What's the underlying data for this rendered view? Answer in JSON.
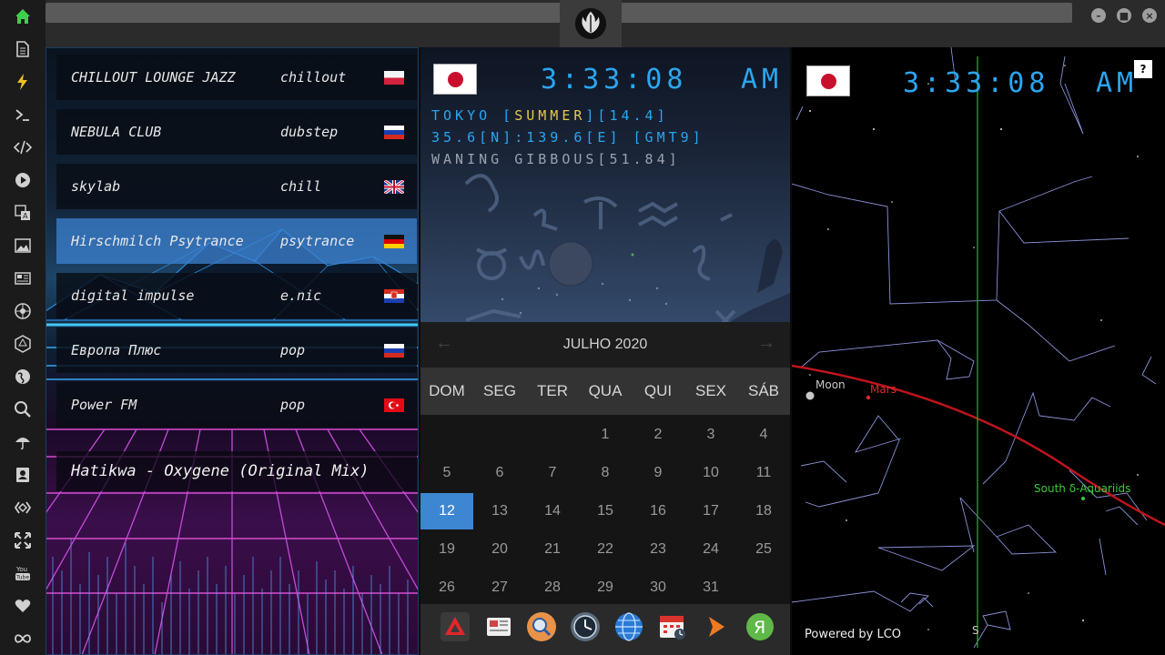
{
  "sidebar": {
    "items": [
      {
        "name": "home-icon",
        "glyph": "home"
      },
      {
        "name": "document-icon",
        "glyph": "doc"
      },
      {
        "name": "lightning-icon",
        "glyph": "bolt"
      },
      {
        "name": "terminal-icon",
        "glyph": ">_"
      },
      {
        "name": "code-icon",
        "glyph": "</>"
      },
      {
        "name": "play-icon",
        "glyph": "play"
      },
      {
        "name": "translate-icon",
        "glyph": "trans"
      },
      {
        "name": "image-icon",
        "glyph": "img"
      },
      {
        "name": "newspaper-icon",
        "glyph": "news"
      },
      {
        "name": "rebel-alliance-icon",
        "glyph": "rebel"
      },
      {
        "name": "hexagon-icon",
        "glyph": "hex"
      },
      {
        "name": "globe-icon",
        "glyph": "globe"
      },
      {
        "name": "search-icon",
        "glyph": "search"
      },
      {
        "name": "umbrella-icon",
        "glyph": "umbrella"
      },
      {
        "name": "contact-icon",
        "glyph": "contact"
      },
      {
        "name": "diamond-link-icon",
        "glyph": "diamond"
      },
      {
        "name": "expand-icon",
        "glyph": "expand"
      },
      {
        "name": "youtube-icon",
        "glyph": "You Tube"
      },
      {
        "name": "heart-icon",
        "glyph": "heart"
      },
      {
        "name": "infinity-icon",
        "glyph": "infinity"
      }
    ],
    "accent": "#3fcf4a"
  },
  "topbar": {
    "logo_icon": "rebel-alliance-icon",
    "window_buttons": [
      "minimize",
      "maximize",
      "close"
    ]
  },
  "radio": {
    "stations": [
      {
        "name": "CHILLOUT LOUNGE JAZZ",
        "genre": "chillout",
        "flag": "poland"
      },
      {
        "name": "NEBULA CLUB",
        "genre": "dubstep",
        "flag": "russia"
      },
      {
        "name": "skylab",
        "genre": "chill",
        "flag": "uk"
      },
      {
        "name": "Hirschmilch Psytrance",
        "genre": "psytrance",
        "flag": "germany"
      },
      {
        "name": "digital impulse",
        "genre": "e.nic",
        "flag": "croatia"
      },
      {
        "name": "Европа Плюс",
        "genre": "pop",
        "flag": "russia"
      },
      {
        "name": "Power FM",
        "genre": "pop",
        "flag": "turkey"
      }
    ],
    "active_index": 3,
    "now_playing": "Hatikwa - Oxygene (Original Mix)"
  },
  "clock": {
    "time": "3:33:08",
    "ampm": "AM",
    "location_line_prefix": "TOKYO [",
    "season": "SUMMER",
    "location_line_suffix": "][14.4]",
    "coords_line": "35.6[N]:139.6[E] [GMT9]",
    "moon_line": "WANING GIBBOUS[51.84]",
    "digit_color": "#2aa6f0",
    "season_color": "#e8c84a"
  },
  "calendar": {
    "month_label": "JULHO 2020",
    "weekdays": [
      "DOM",
      "SEG",
      "TER",
      "QUA",
      "QUI",
      "SEX",
      "SÁB"
    ],
    "first_weekday_index": 3,
    "days_in_month": 31,
    "today": 12,
    "prev_label": "←",
    "next_label": "→",
    "today_color": "#3d86d2"
  },
  "dock": {
    "icons": [
      "anydesk-icon",
      "news-reader-icon",
      "search-app-icon",
      "clock-app-icon",
      "browser-globe-icon",
      "calendar-app-icon",
      "arrow-app-icon",
      "yandex-icon"
    ]
  },
  "starmap": {
    "time": "3:33:08",
    "ampm": "AM",
    "help_label": "?",
    "labels": {
      "moon": "Moon",
      "mars": "Mars",
      "meteor_shower": "South δ-Aquariids",
      "south": "S"
    },
    "powered_by": "Powered by LCO",
    "ecliptic_color": "#c0141c",
    "meridian_color": "#1aa81a",
    "constellation_color": "#8a92d8"
  }
}
